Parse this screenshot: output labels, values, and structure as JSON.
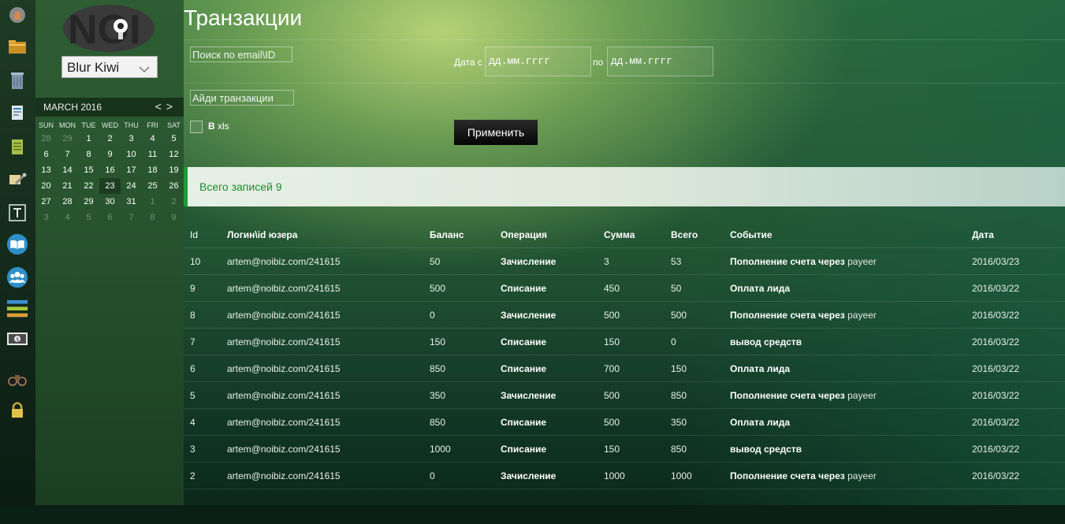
{
  "app": {
    "title": "Транзакции",
    "site_name": "Blur Kiwi",
    "logo_text": "NOI"
  },
  "colors": {
    "accent": "#1e9a38",
    "total_text": "#1d8a2f",
    "button_bg": "#111111"
  },
  "rail_icons": [
    "home-icon",
    "folder-icon",
    "trash-icon",
    "document-icon",
    "notepad-icon",
    "tools-icon",
    "text-icon",
    "book-icon",
    "users-icon",
    "stack-icon",
    "money-icon",
    "binoculars-icon",
    "lock-icon"
  ],
  "calendar": {
    "month_label": "MARCH 2016",
    "prev": "<",
    "next": ">",
    "dow": [
      "SUN",
      "MON",
      "TUE",
      "WED",
      "THU",
      "FRI",
      "SAT"
    ],
    "weeks": [
      [
        {
          "d": "28",
          "m": true
        },
        {
          "d": "29",
          "m": true
        },
        {
          "d": "1"
        },
        {
          "d": "2"
        },
        {
          "d": "3"
        },
        {
          "d": "4"
        },
        {
          "d": "5"
        }
      ],
      [
        {
          "d": "6"
        },
        {
          "d": "7"
        },
        {
          "d": "8"
        },
        {
          "d": "9"
        },
        {
          "d": "10"
        },
        {
          "d": "11"
        },
        {
          "d": "12"
        }
      ],
      [
        {
          "d": "13"
        },
        {
          "d": "14"
        },
        {
          "d": "15"
        },
        {
          "d": "16"
        },
        {
          "d": "17"
        },
        {
          "d": "18"
        },
        {
          "d": "19"
        }
      ],
      [
        {
          "d": "20"
        },
        {
          "d": "21"
        },
        {
          "d": "22"
        },
        {
          "d": "23",
          "t": true
        },
        {
          "d": "24"
        },
        {
          "d": "25"
        },
        {
          "d": "26"
        }
      ],
      [
        {
          "d": "27"
        },
        {
          "d": "28"
        },
        {
          "d": "29"
        },
        {
          "d": "30"
        },
        {
          "d": "31"
        },
        {
          "d": "1",
          "m": true
        },
        {
          "d": "2",
          "m": true
        }
      ],
      [
        {
          "d": "3",
          "m": true
        },
        {
          "d": "4",
          "m": true
        },
        {
          "d": "5",
          "m": true
        },
        {
          "d": "6",
          "m": true
        },
        {
          "d": "7",
          "m": true
        },
        {
          "d": "8",
          "m": true
        },
        {
          "d": "9",
          "m": true
        }
      ]
    ]
  },
  "filters": {
    "search_placeholder": "Поиск по email\\ID",
    "txid_placeholder": "Айди транзакции",
    "date_from_label": "Дата с",
    "date_from_value": "дд.мм.гггг",
    "date_to_label": "по",
    "date_to_value": "дд.мм.гггг",
    "xls_bold": "В",
    "xls_rest": " xls",
    "apply_label": "Применить"
  },
  "total": "Всего записей 9",
  "table": {
    "headers": [
      "Id",
      "Логин\\id юзера",
      "Баланс",
      "Операция",
      "Сумма",
      "Всего",
      "Событие",
      "Дата"
    ],
    "rows": [
      [
        "10",
        "artem@noibiz.com/241615",
        "50",
        "Зачисление",
        "3",
        "53",
        "Пополнение счета через",
        " payeer",
        "2016/03/23"
      ],
      [
        "9",
        "artem@noibiz.com/241615",
        "500",
        "Списание",
        "450",
        "50",
        "Оплата лида",
        "",
        "2016/03/22"
      ],
      [
        "8",
        "artem@noibiz.com/241615",
        "0",
        "Зачисление",
        "500",
        "500",
        "Пополнение счета через",
        " payeer",
        "2016/03/22"
      ],
      [
        "7",
        "artem@noibiz.com/241615",
        "150",
        "Списание",
        "150",
        "0",
        "вывод средств",
        "",
        "2016/03/22"
      ],
      [
        "6",
        "artem@noibiz.com/241615",
        "850",
        "Списание",
        "700",
        "150",
        "Оплата лида",
        "",
        "2016/03/22"
      ],
      [
        "5",
        "artem@noibiz.com/241615",
        "350",
        "Зачисление",
        "500",
        "850",
        "Пополнение счета через",
        " payeer",
        "2016/03/22"
      ],
      [
        "4",
        "artem@noibiz.com/241615",
        "850",
        "Списание",
        "500",
        "350",
        "Оплата лида",
        "",
        "2016/03/22"
      ],
      [
        "3",
        "artem@noibiz.com/241615",
        "1000",
        "Списание",
        "150",
        "850",
        "вывод средств",
        "",
        "2016/03/22"
      ],
      [
        "2",
        "artem@noibiz.com/241615",
        "0",
        "Зачисление",
        "1000",
        "1000",
        "Пополнение счета через",
        " payeer",
        "2016/03/22"
      ]
    ]
  }
}
